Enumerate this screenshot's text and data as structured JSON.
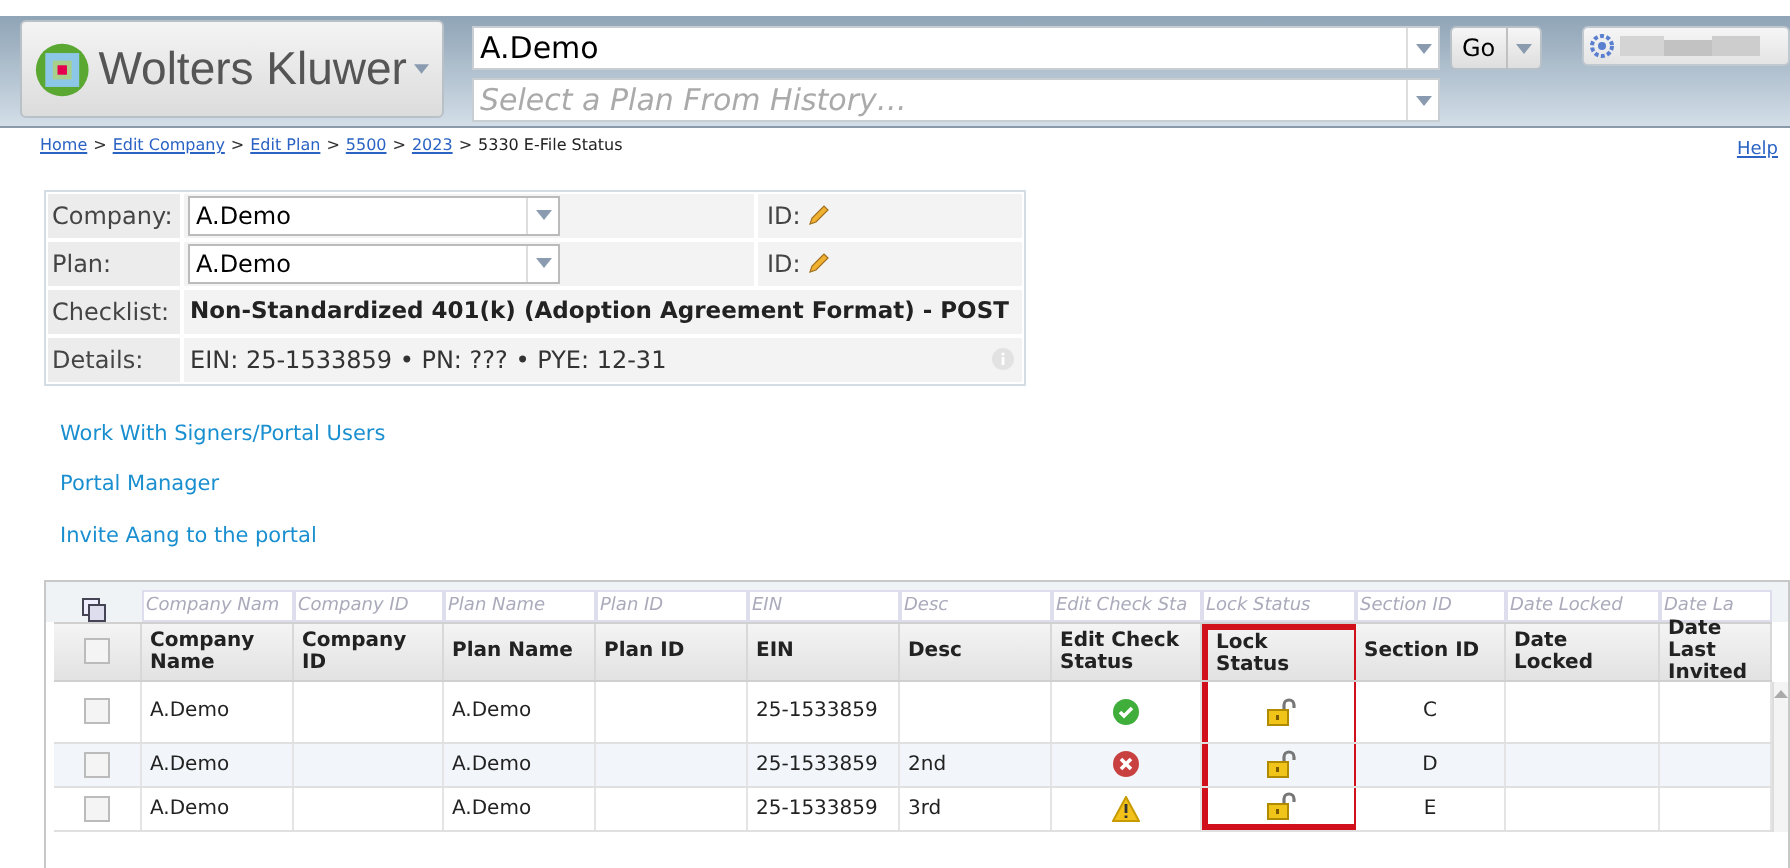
{
  "header": {
    "logo_text": "Wolters Kluwer",
    "search_value": "A.Demo",
    "history_placeholder": "Select a Plan From History…",
    "go_label": "Go"
  },
  "breadcrumb": [
    {
      "label": "Home",
      "kind": "link"
    },
    {
      "label": ">",
      "kind": "separator"
    },
    {
      "label": "Edit Company",
      "kind": "link"
    },
    {
      "label": ">",
      "kind": "separator"
    },
    {
      "label": "Edit Plan",
      "kind": "link"
    },
    {
      "label": ">",
      "kind": "separator"
    },
    {
      "label": "5500",
      "kind": "link"
    },
    {
      "label": ">",
      "kind": "separator"
    },
    {
      "label": "2023",
      "kind": "link"
    },
    {
      "label": ">",
      "kind": "separator"
    },
    {
      "label": "5330 E-File Status",
      "kind": "current"
    }
  ],
  "help": "Help",
  "info": [
    {
      "label": "Company:",
      "kind": "select",
      "value": "A.Demo",
      "id_label": "ID:"
    },
    {
      "label": "Plan:",
      "kind": "select",
      "value": "A.Demo",
      "id_label": "ID:"
    },
    {
      "label": "Checklist:",
      "kind": "bold",
      "value": "Non-Standardized 401(k) (Adoption Agreement Format) - POST"
    },
    {
      "label": "Details:",
      "kind": "details",
      "value": "EIN: 25-1533859 • PN: ??? • PYE: 12-31"
    }
  ],
  "links": [
    "Work With Signers/Portal Users",
    "Portal Manager",
    "Invite Aang to the portal"
  ],
  "grid": {
    "select_all_checked": false,
    "columns": [
      {
        "filter": "Company Nam",
        "title": "Company Name",
        "highlighted": false
      },
      {
        "filter": "Company ID",
        "title": "Company ID",
        "highlighted": false
      },
      {
        "filter": "Plan Name",
        "title": "Plan Name",
        "highlighted": false
      },
      {
        "filter": "Plan ID",
        "title": "Plan ID",
        "highlighted": false
      },
      {
        "filter": "EIN",
        "title": "EIN",
        "highlighted": false
      },
      {
        "filter": "Desc",
        "title": "Desc",
        "highlighted": false
      },
      {
        "filter": "Edit Check Sta",
        "title": "Edit Check Status",
        "highlighted": false
      },
      {
        "filter": "Lock Status",
        "title": "Lock Status",
        "highlighted": true
      },
      {
        "filter": "Section ID",
        "title": "Section ID",
        "highlighted": false
      },
      {
        "filter": "Date Locked",
        "title": "Date Locked",
        "highlighted": false
      },
      {
        "filter": "Date La",
        "title": "Date Last Invited",
        "highlighted": false
      }
    ],
    "rows": [
      {
        "checked": false,
        "company_name": "A.Demo",
        "company_id": "",
        "plan_name": "A.Demo",
        "plan_id": "",
        "ein": "25-1533859",
        "desc": "",
        "edit_check": {
          "kind": "ok"
        },
        "lock": {
          "kind": "unlocked"
        },
        "section_id": "C",
        "date_locked": "",
        "date_last_invited": ""
      },
      {
        "checked": false,
        "company_name": "A.Demo",
        "company_id": "",
        "plan_name": "A.Demo",
        "plan_id": "",
        "ein": "25-1533859",
        "desc": "2nd",
        "edit_check": {
          "kind": "error"
        },
        "lock": {
          "kind": "unlocked"
        },
        "section_id": "D",
        "date_locked": "",
        "date_last_invited": ""
      },
      {
        "checked": false,
        "company_name": "A.Demo",
        "company_id": "",
        "plan_name": "A.Demo",
        "plan_id": "",
        "ein": "25-1533859",
        "desc": "3rd",
        "edit_check": {
          "kind": "warning"
        },
        "lock": {
          "kind": "unlocked"
        },
        "section_id": "E",
        "date_locked": "",
        "date_last_invited": ""
      }
    ]
  }
}
